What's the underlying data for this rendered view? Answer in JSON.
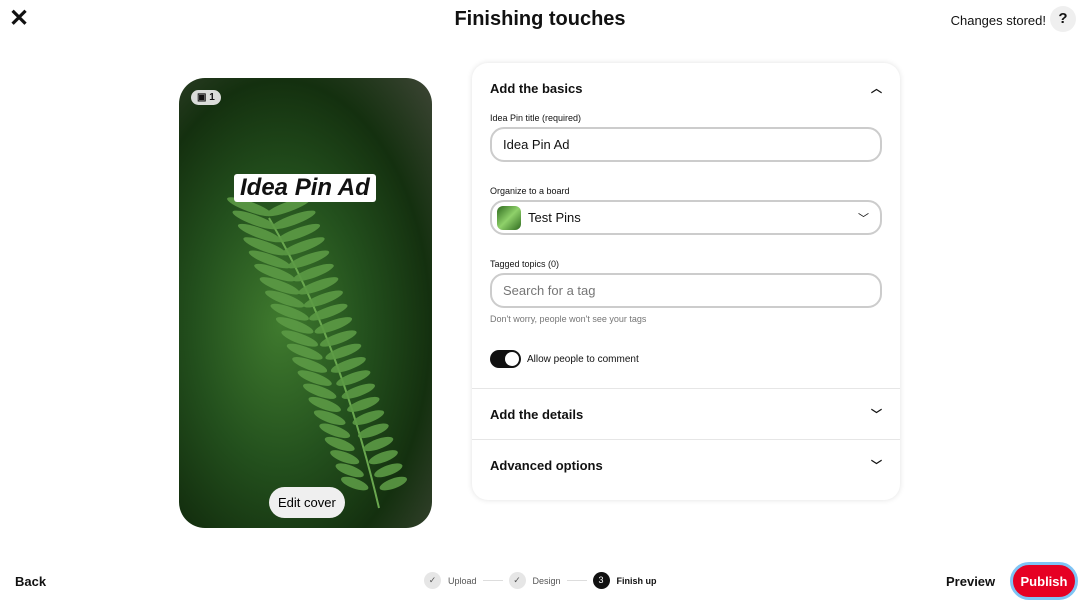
{
  "header": {
    "title": "Finishing touches",
    "status": "Changes stored!",
    "help": "?"
  },
  "preview": {
    "page_count": "1",
    "title": "Idea Pin Ad",
    "edit_cover": "Edit cover"
  },
  "basics": {
    "heading": "Add the basics",
    "title_label": "Idea Pin title (required)",
    "title_value": "Idea Pin Ad",
    "board_label": "Organize to a board",
    "board_value": "Test Pins",
    "topics_label": "Tagged topics (0)",
    "topics_placeholder": "Search for a tag",
    "topics_hint": "Don't worry, people won't see your tags",
    "comment_toggle": "Allow people to comment",
    "comment_enabled": true
  },
  "sections": {
    "details": "Add the details",
    "advanced": "Advanced options"
  },
  "footer": {
    "back": "Back",
    "steps": [
      {
        "label": "Upload",
        "state": "done"
      },
      {
        "label": "Design",
        "state": "done"
      },
      {
        "label": "Finish up",
        "number": "3",
        "state": "current"
      }
    ],
    "preview": "Preview",
    "publish": "Publish"
  },
  "colors": {
    "accent": "#e60023"
  }
}
